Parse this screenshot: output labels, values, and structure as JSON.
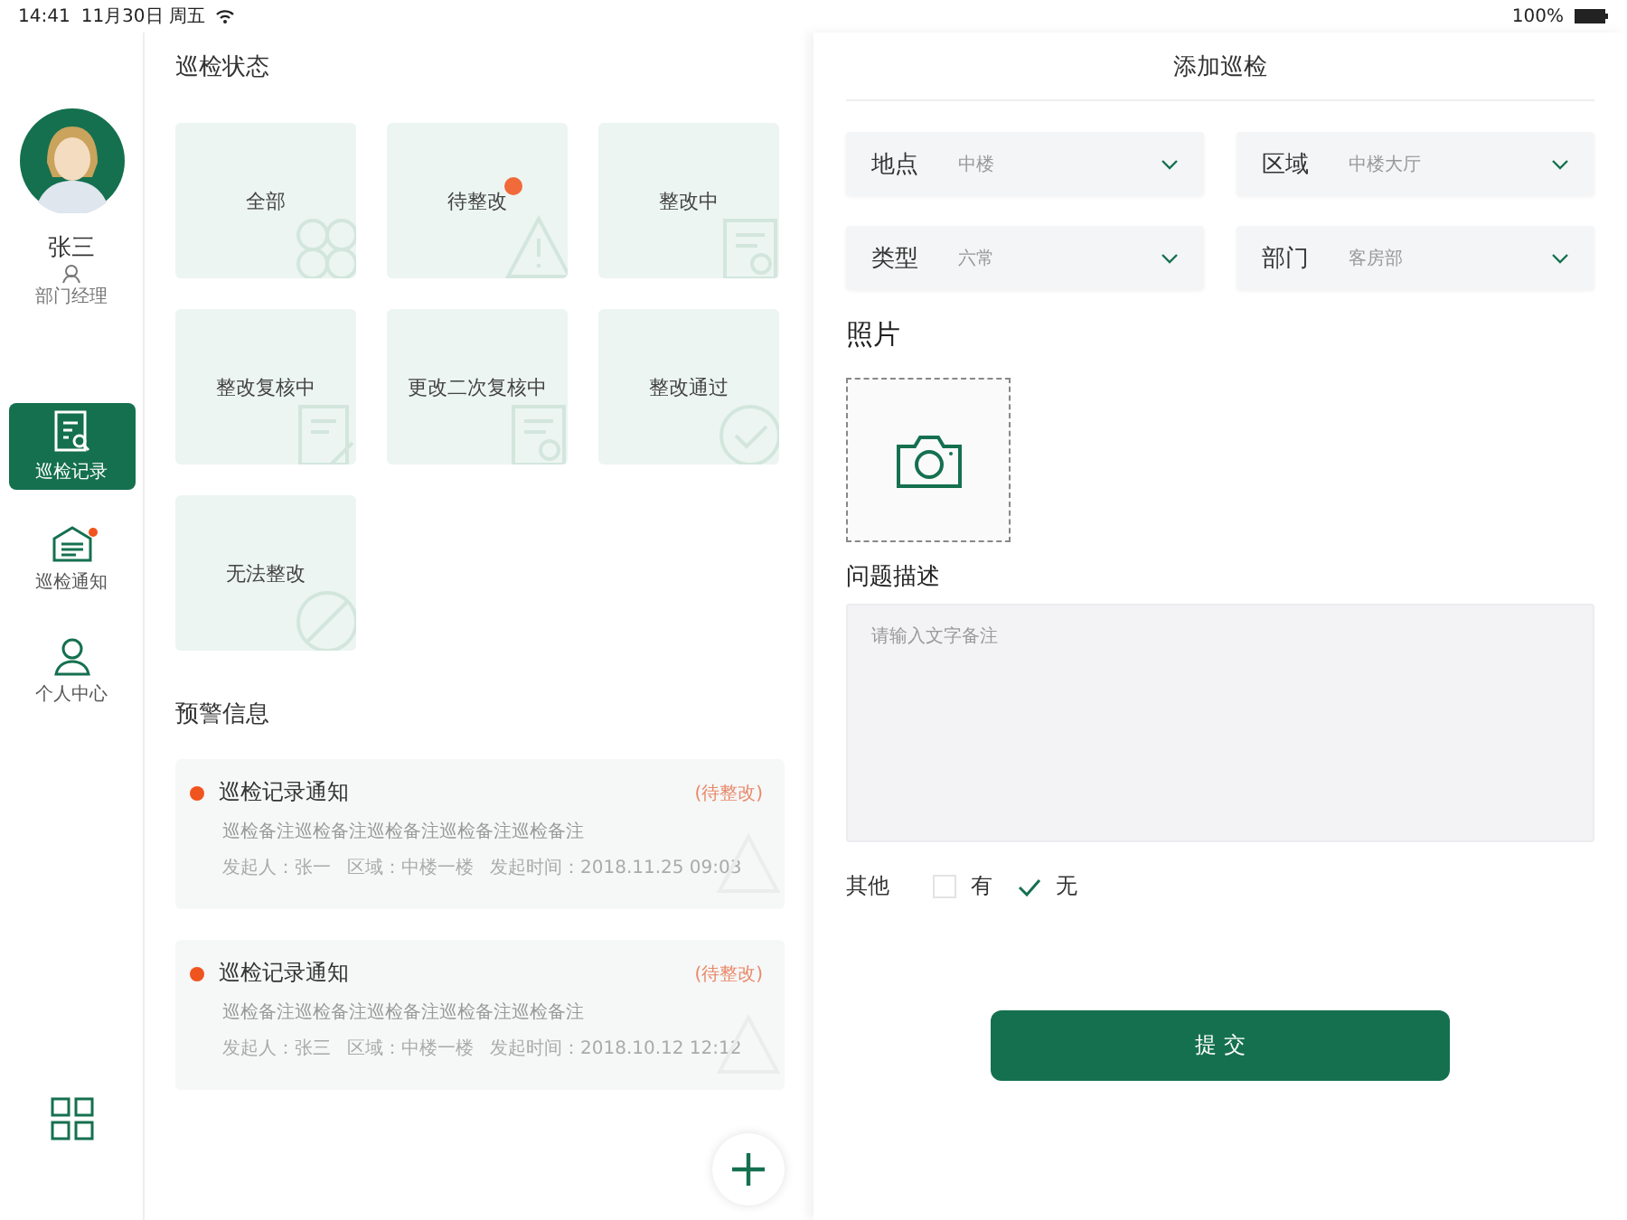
{
  "status_bar": {
    "time": "14:41",
    "date": "11月30日 周五",
    "battery": "100%"
  },
  "sidebar": {
    "user_name": "张三",
    "user_role": "部门经理",
    "items": [
      {
        "label": "巡检记录",
        "kind": "record",
        "selected": true,
        "unread": false
      },
      {
        "label": "巡检通知",
        "kind": "notice",
        "selected": false,
        "unread": true
      },
      {
        "label": "个人中心",
        "kind": "person",
        "selected": false,
        "unread": false
      }
    ]
  },
  "status_panel": {
    "title": "巡检状态",
    "tiles": [
      {
        "label": "全部",
        "kind": "all",
        "badge": false
      },
      {
        "label": "待整改",
        "kind": "warn",
        "badge": true
      },
      {
        "label": "整改中",
        "kind": "doc",
        "badge": false
      },
      {
        "label": "整改复核中",
        "kind": "review",
        "badge": false
      },
      {
        "label": "更改二次复核中",
        "kind": "doc",
        "badge": false
      },
      {
        "label": "整改通过",
        "kind": "check",
        "badge": false
      },
      {
        "label": "无法整改",
        "kind": "ban",
        "badge": false
      }
    ]
  },
  "alerts": {
    "title": "预警信息",
    "items": [
      {
        "title": "巡检记录通知",
        "status": "(待整改)",
        "note": "巡检备注巡检备注巡检备注巡检备注巡检备注",
        "sender": "发起人：张一",
        "area": "区域：中楼一楼",
        "time": "发起时间：2018.11.25 09:03"
      },
      {
        "title": "巡检记录通知",
        "status": "(待整改)",
        "note": "巡检备注巡检备注巡检备注巡检备注巡检备注",
        "sender": "发起人：张三",
        "area": "区域：中楼一楼",
        "time": "发起时间：2018.10.12 12:12"
      }
    ]
  },
  "form": {
    "title": "添加巡检",
    "selects": [
      {
        "label": "地点",
        "value": "中楼"
      },
      {
        "label": "区域",
        "value": "中楼大厅"
      },
      {
        "label": "类型",
        "value": "六常"
      },
      {
        "label": "部门",
        "value": "客房部"
      }
    ],
    "photo_label": "照片",
    "description_label": "问题描述",
    "description_placeholder": "请输入文字备注",
    "other_label": "其他",
    "options": [
      {
        "label": "有",
        "checked": false
      },
      {
        "label": "无",
        "checked": true
      }
    ],
    "submit": "提 交"
  }
}
